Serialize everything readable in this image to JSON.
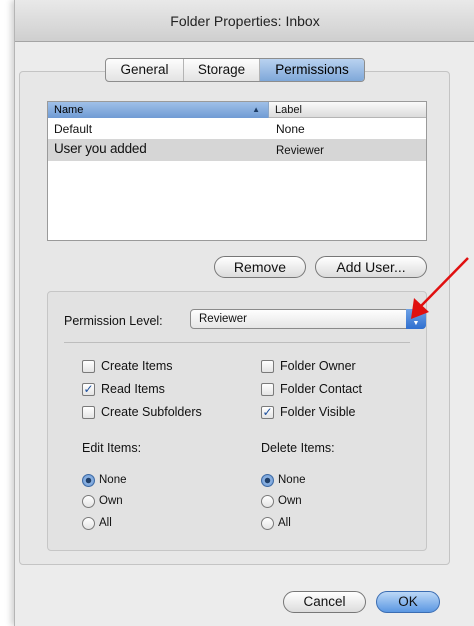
{
  "window": {
    "title": "Folder Properties: Inbox"
  },
  "tabs": [
    {
      "label": "General",
      "active": false
    },
    {
      "label": "Storage",
      "active": false
    },
    {
      "label": "Permissions",
      "active": true
    }
  ],
  "table": {
    "columns": [
      "Name",
      "Label"
    ],
    "rows": [
      {
        "name": "Default",
        "label": "None",
        "selected": false
      },
      {
        "name": "User you added",
        "label": "Reviewer",
        "selected": true
      }
    ]
  },
  "buttons": {
    "remove": "Remove",
    "add_user": "Add User...",
    "cancel": "Cancel",
    "ok": "OK"
  },
  "permission": {
    "label": "Permission Level:",
    "selected": "Reviewer",
    "checks": [
      {
        "label": "Create Items",
        "checked": false
      },
      {
        "label": "Read Items",
        "checked": true
      },
      {
        "label": "Create Subfolders",
        "checked": false
      },
      {
        "label": "Folder Owner",
        "checked": false
      },
      {
        "label": "Folder Contact",
        "checked": false
      },
      {
        "label": "Folder Visible",
        "checked": true
      }
    ],
    "edit_items": {
      "label": "Edit Items:",
      "options": [
        {
          "label": "None",
          "selected": true
        },
        {
          "label": "Own",
          "selected": false
        },
        {
          "label": "All",
          "selected": false
        }
      ]
    },
    "delete_items": {
      "label": "Delete Items:",
      "options": [
        {
          "label": "None",
          "selected": true
        },
        {
          "label": "Own",
          "selected": false
        },
        {
          "label": "All",
          "selected": false
        }
      ]
    }
  },
  "colors": {
    "accent": "#6f9bd4",
    "annotation_arrow": "#e01010"
  },
  "icons": {
    "sort": "sort-ascending-icon",
    "popup": "popup-arrows-icon",
    "annotation": "red-arrow-icon"
  }
}
